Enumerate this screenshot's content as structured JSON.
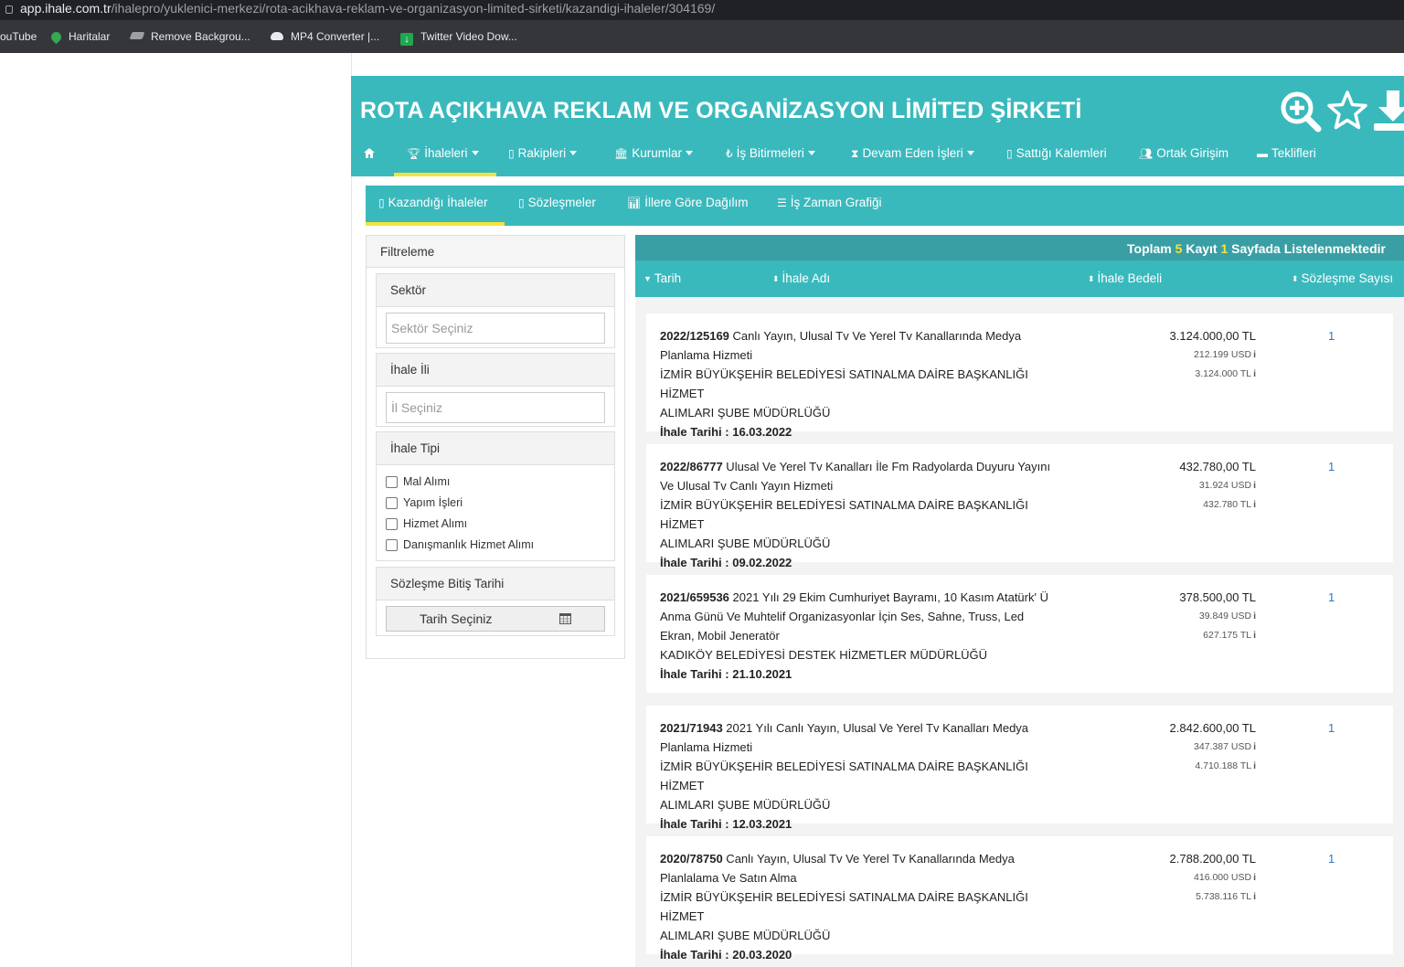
{
  "browser": {
    "url_host": "app.ihale.com.tr",
    "url_path": "/ihalepro/yuklenici-merkezi/rota-acikhava-reklam-ve-organizasyon-limited-sirketi/kazandigi-ihaleler/304169/",
    "bookmarks": [
      {
        "label": "ouTube"
      },
      {
        "label": "Haritalar"
      },
      {
        "label": "Remove Backgrou..."
      },
      {
        "label": "MP4 Converter |..."
      },
      {
        "label": "Twitter Video Dow..."
      }
    ]
  },
  "header": {
    "company": "ROTA AÇIKHAVA REKLAM VE ORGANİZASYON LİMİTED ŞİRKETİ",
    "icons": [
      "zoom-in-icon",
      "star-icon",
      "download-icon"
    ]
  },
  "nav": {
    "items": [
      {
        "label": "İhaleleri",
        "icon": "trophy-icon"
      },
      {
        "label": "Rakipleri",
        "icon": "document-icon"
      },
      {
        "label": "Kurumlar",
        "icon": "institution-icon"
      },
      {
        "label": "İş Bitirmeleri",
        "icon": "money-icon"
      },
      {
        "label": "Devam Eden İşleri",
        "icon": "hourglass-icon"
      },
      {
        "label": "Sattığı Kalemleri",
        "icon": "document-icon"
      },
      {
        "label": "Ortak Girişim",
        "icon": "users-icon"
      },
      {
        "label": "Teklifleri",
        "icon": "inbox-icon"
      }
    ]
  },
  "subnav": {
    "items": [
      {
        "label": "Kazandığı İhaleler"
      },
      {
        "label": "Sözleşmeler"
      },
      {
        "label": "İllere Göre Dağılım"
      },
      {
        "label": "İş Zaman Grafiği"
      }
    ]
  },
  "filter": {
    "title": "Filtreleme",
    "sector": {
      "label": "Sektör",
      "placeholder": "Sektör Seçiniz"
    },
    "city": {
      "label": "İhale İli",
      "placeholder": "İl Seçiniz"
    },
    "type": {
      "label": "İhale Tipi",
      "options": [
        "Mal Alımı",
        "Yapım İşleri",
        "Hizmet Alımı",
        "Danışmanlık Hizmet Alımı"
      ]
    },
    "end_date": {
      "label": "Sözleşme Bitiş Tarihi",
      "button": "Tarih Seçiniz"
    }
  },
  "results": {
    "summary_prefix": "Toplam ",
    "total": "5",
    "summary_mid": " Kayıt ",
    "pages": "1",
    "summary_suffix": " Sayfada Listelenmektedir",
    "columns": {
      "date": "Tarih",
      "name": "İhale Adı",
      "amount": "İhale Bedeli",
      "contracts": "Sözleşme Sayısı"
    },
    "rows": [
      {
        "code": "2022/125169",
        "title_lines": [
          " Canlı Yayın, Ulusal Tv Ve Yerel Tv Kanallarında Medya",
          "Planlama Hizmeti"
        ],
        "org_lines": [
          "İZMİR BÜYÜKŞEHİR BELEDİYESİ SATINALMA DAİRE BAŞKANLIĞI HİZMET",
          "ALIMLARI ŞUBE MÜDÜRLÜĞÜ"
        ],
        "date_label": "İhale Tarihi : ",
        "date": "16.03.2022",
        "amount": "3.124.000,00 TL",
        "usd": "212.199 USD",
        "tl": "3.124.000 TL",
        "contracts": "1"
      },
      {
        "code": "2022/86777",
        "title_lines": [
          " Ulusal Ve Yerel Tv Kanalları İle Fm Radyolarda Duyuru Yayını",
          "Ve Ulusal Tv Canlı Yayın Hizmeti"
        ],
        "org_lines": [
          "İZMİR BÜYÜKŞEHİR BELEDİYESİ SATINALMA DAİRE BAŞKANLIĞI HİZMET",
          "ALIMLARI ŞUBE MÜDÜRLÜĞÜ"
        ],
        "date_label": "İhale Tarihi : ",
        "date": "09.02.2022",
        "amount": "432.780,00 TL",
        "usd": "31.924 USD",
        "tl": "432.780 TL",
        "contracts": "1"
      },
      {
        "code": "2021/659536",
        "title_lines": [
          " 2021 Yılı 29 Ekim Cumhuriyet Bayramı, 10 Kasım Atatürk' Ü",
          "Anma Günü Ve Muhtelif Organizasyonlar İçin Ses, Sahne, Truss, Led",
          "Ekran, Mobil Jeneratör"
        ],
        "org_lines": [
          "KADIKÖY BELEDİYESİ DESTEK HİZMETLER MÜDÜRLÜĞÜ"
        ],
        "date_label": "İhale Tarihi : ",
        "date": "21.10.2021",
        "amount": "378.500,00 TL",
        "usd": "39.849 USD",
        "tl": "627.175 TL",
        "contracts": "1"
      },
      {
        "code": "2021/71943",
        "title_lines": [
          " 2021 Yılı Canlı Yayın, Ulusal Ve Yerel Tv Kanalları Medya",
          "Planlama Hizmeti"
        ],
        "org_lines": [
          "İZMİR BÜYÜKŞEHİR BELEDİYESİ SATINALMA DAİRE BAŞKANLIĞI HİZMET",
          "ALIMLARI ŞUBE MÜDÜRLÜĞÜ"
        ],
        "date_label": "İhale Tarihi : ",
        "date": "12.03.2021",
        "amount": "2.842.600,00 TL",
        "usd": "347.387 USD",
        "tl": "4.710.188 TL",
        "contracts": "1"
      },
      {
        "code": "2020/78750",
        "title_lines": [
          " Canlı Yayın, Ulusal Tv Ve Yerel Tv Kanallarında Medya",
          "Planlalama Ve Satın Alma"
        ],
        "org_lines": [
          "İZMİR BÜYÜKŞEHİR BELEDİYESİ SATINALMA DAİRE BAŞKANLIĞI HİZMET",
          "ALIMLARI ŞUBE MÜDÜRLÜĞÜ"
        ],
        "date_label": "İhale Tarihi : ",
        "date": "20.03.2020",
        "amount": "2.788.200,00 TL",
        "usd": "416.000 USD",
        "tl": "5.738.116 TL",
        "contracts": "1"
      }
    ]
  },
  "colors": {
    "teal": "#3ab9bd",
    "teal_dark": "#3a9fa4",
    "accent": "#f5e23a",
    "link": "#2a78c2"
  }
}
